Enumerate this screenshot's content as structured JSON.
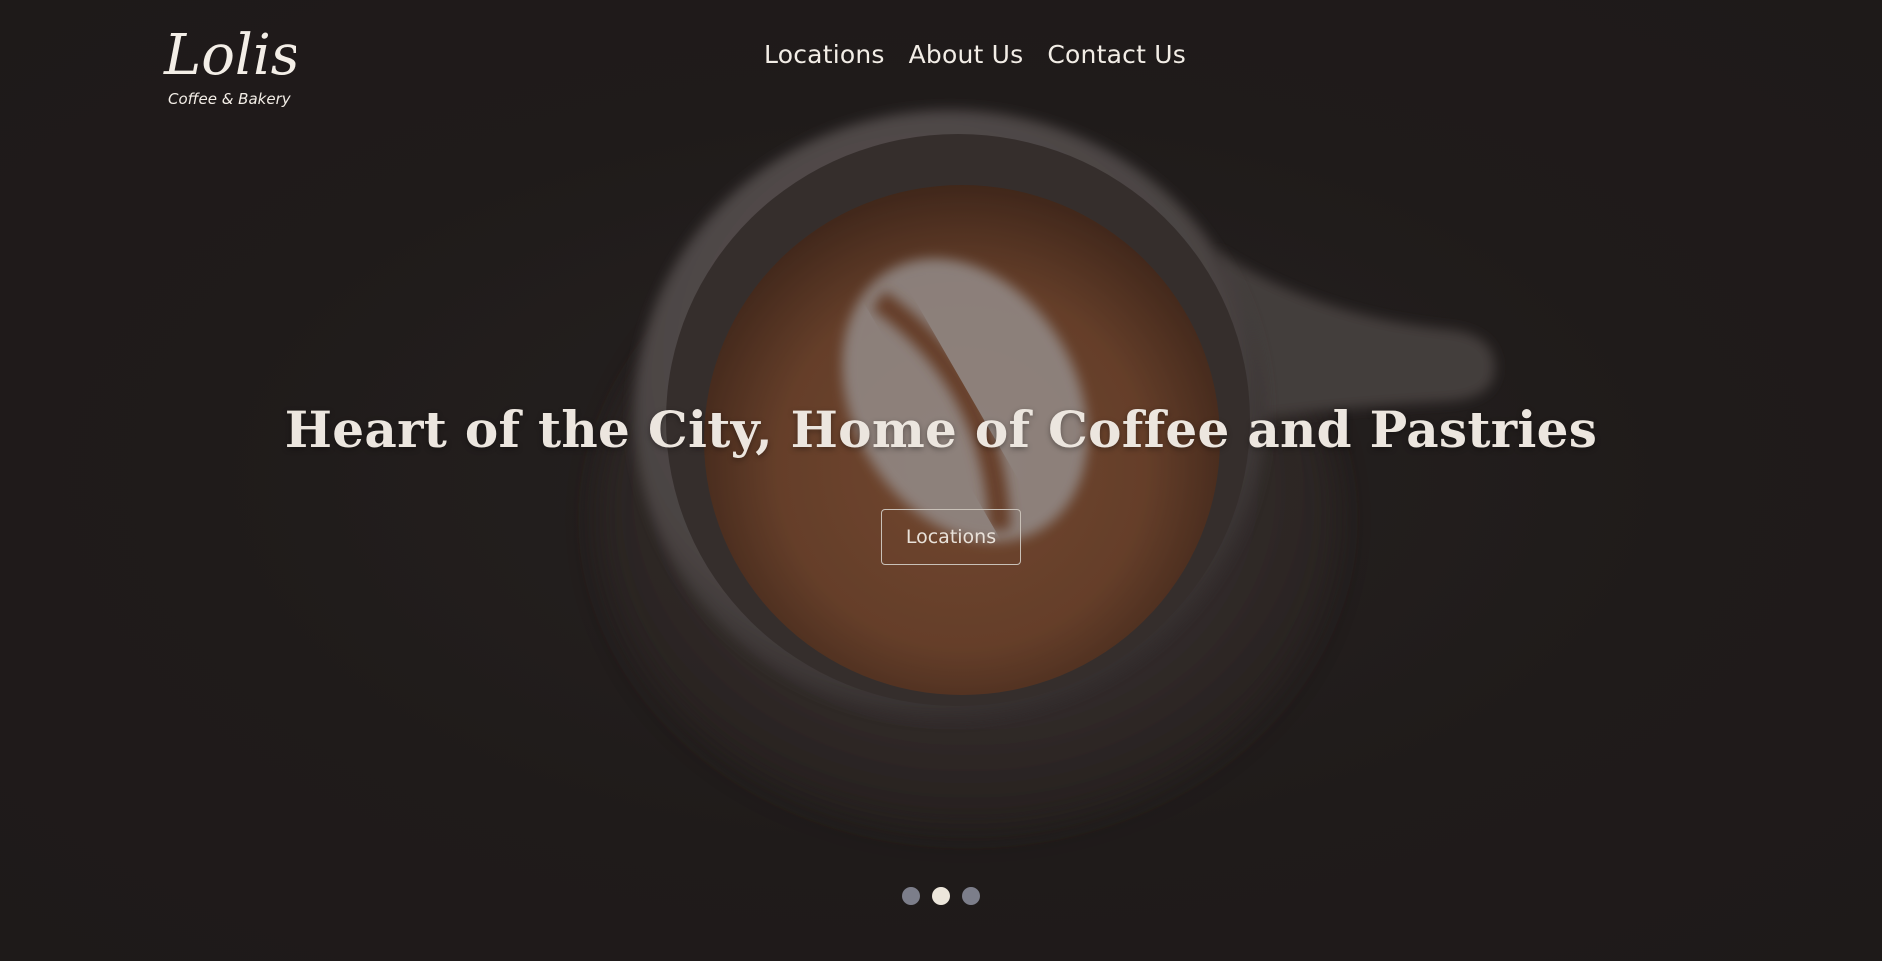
{
  "brand": {
    "logo_text": "Lolis",
    "logo_subtext": "Coffee & Bakery"
  },
  "nav": {
    "items": [
      {
        "label": "Locations"
      },
      {
        "label": "About Us"
      },
      {
        "label": "Contact Us"
      }
    ]
  },
  "hero": {
    "headline": "Heart of the City, Home of Coffee and Pastries",
    "cta_label": "Locations",
    "image_subject": "coffee-cup-latte-art-bean"
  },
  "carousel": {
    "slide_count": 3,
    "active_index": 1
  },
  "colors": {
    "background": "#201c1b",
    "text": "#ece6df",
    "dot_inactive": "#7c7e8a",
    "dot_active": "#ece6db"
  }
}
